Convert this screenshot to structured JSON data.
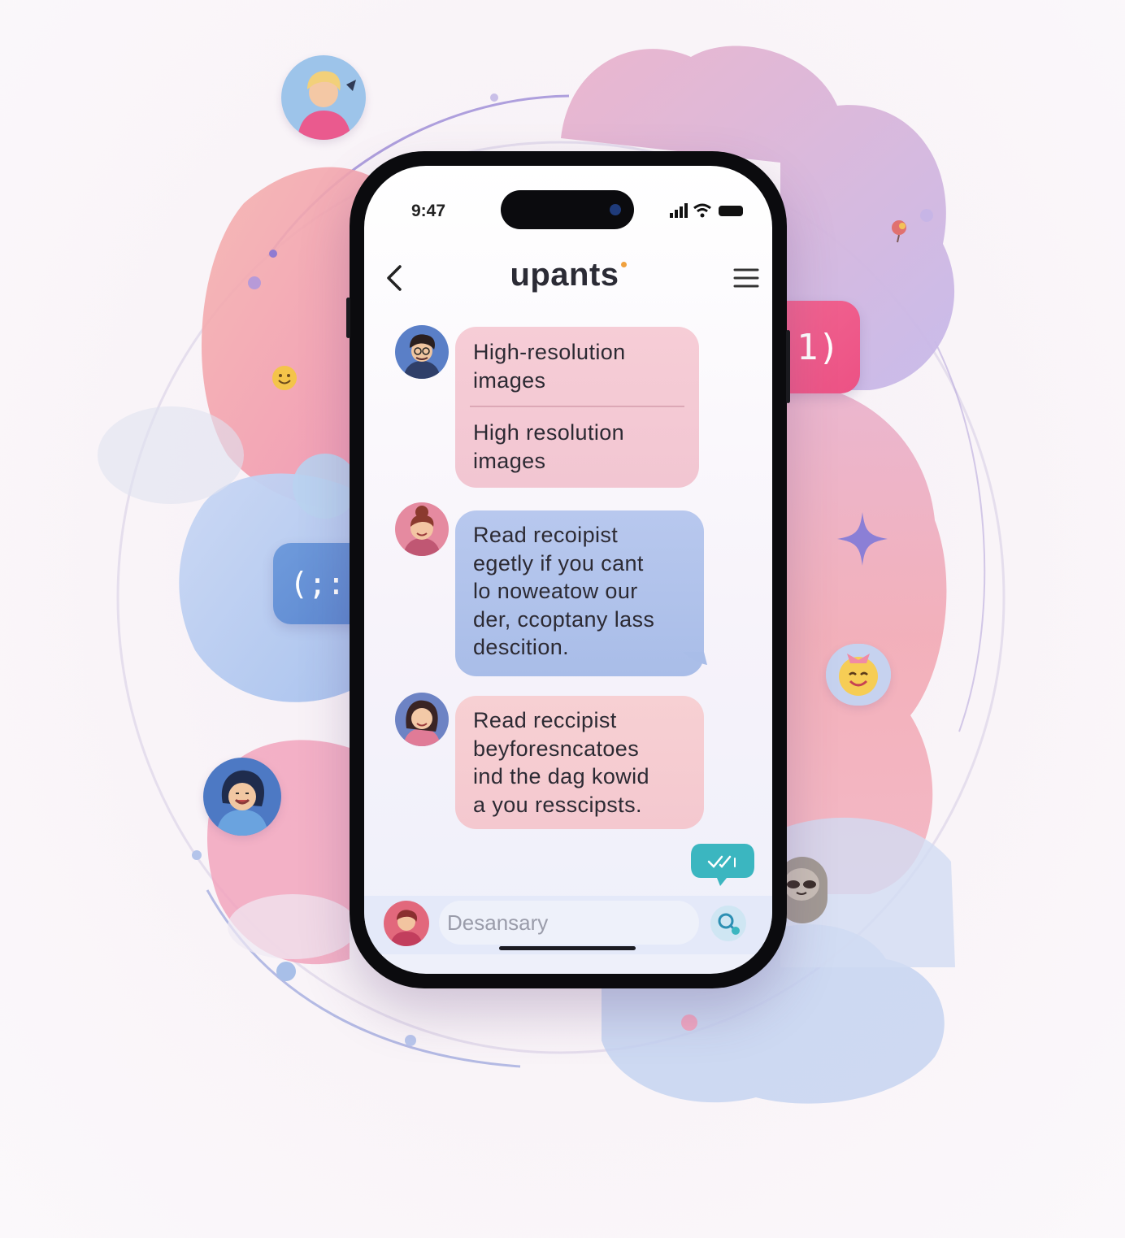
{
  "status_bar": {
    "time": "9:47"
  },
  "header": {
    "title": "upants",
    "back_icon": "chevron-left-icon",
    "menu_icon": "hamburger-menu-icon"
  },
  "messages": [
    {
      "avatar": "man-with-glasses-avatar",
      "color": "#f3c8d2",
      "parts": [
        {
          "lines": [
            "High-resolution",
            "images"
          ]
        },
        {
          "lines": [
            "High resolution",
            "images"
          ]
        }
      ]
    },
    {
      "avatar": "woman-with-bun-avatar",
      "color": "#acc0ea",
      "lines": [
        "Read recoipist",
        "egetly if you cant",
        "lo noweatow our",
        "der, ccoptany lass",
        "descition."
      ]
    },
    {
      "avatar": "woman-dark-hair-avatar",
      "color": "#f5cbd1",
      "lines": [
        "Read reccipist",
        "beyforesncatoes",
        "ind the dag kowid",
        "a you resscipsts."
      ]
    }
  ],
  "read_receipt_icon": "double-check-icon",
  "composer": {
    "placeholder": "Desansary",
    "avatar": "user-avatar",
    "action_icon": "search-chat-icon"
  },
  "floating": {
    "pink_bubble_text": "ͳ:1)",
    "blue_bubble_text": "(;:)",
    "avatars": [
      "woman-blonde-avatar",
      "laughing-woman-avatar",
      "smiling-emoji-avatar",
      "sloth-avatar"
    ],
    "sparkle_icon": "four-point-star-icon"
  },
  "colors": {
    "accent_pink": "#ec5184",
    "accent_blue": "#5b86cf",
    "accent_teal": "#3bb6c0",
    "phone_frame": "#0b0b0e"
  }
}
